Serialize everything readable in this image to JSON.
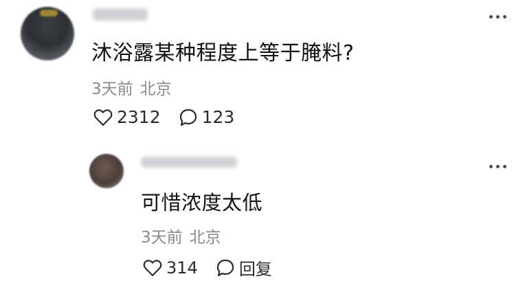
{
  "comment": {
    "text": "沐浴露某种程度上等于腌料?",
    "time": "3天前",
    "location": "北京",
    "likes": "2312",
    "replies": "123"
  },
  "reply": {
    "text": "可惜浓度太低",
    "time": "3天前",
    "location": "北京",
    "likes": "314",
    "reply_label": "回复"
  }
}
